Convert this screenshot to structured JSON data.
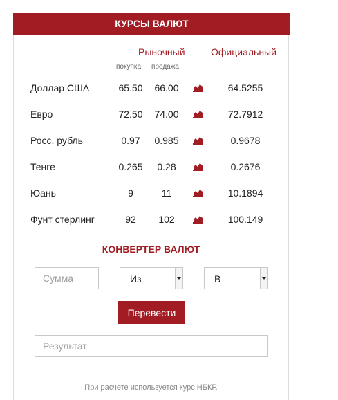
{
  "widget": {
    "title": "КУРСЫ ВАЛЮТ",
    "market_label": "Рыночный",
    "official_label": "Официальный",
    "buy_label": "покупка",
    "sell_label": "продажа",
    "rows": [
      {
        "name": "Доллар США",
        "buy": "65.50",
        "sell": "66.00",
        "official": "64.5255"
      },
      {
        "name": "Евро",
        "buy": "72.50",
        "sell": "74.00",
        "official": "72.7912"
      },
      {
        "name": "Росс. рубль",
        "buy": "0.97",
        "sell": "0.985",
        "official": "0.9678"
      },
      {
        "name": "Тенге",
        "buy": "0.265",
        "sell": "0.28",
        "official": "0.2676"
      },
      {
        "name": "Юань",
        "buy": "9",
        "sell": "11",
        "official": "10.1894"
      },
      {
        "name": "Фунт стерлинг",
        "buy": "92",
        "sell": "102",
        "official": "100.149"
      }
    ],
    "chart_icon": "chart-icon"
  },
  "converter": {
    "title": "КОНВЕРТЕР ВАЛЮТ",
    "amount_placeholder": "Сумма",
    "from_value": "Из",
    "to_value": "В",
    "convert_label": "Перевести",
    "result_placeholder": "Результат",
    "footnote": "При расчете используется курс НБКР."
  },
  "colors": {
    "accent": "#a21c23",
    "border": "#c8c8c8",
    "muted_text": "#888888"
  }
}
